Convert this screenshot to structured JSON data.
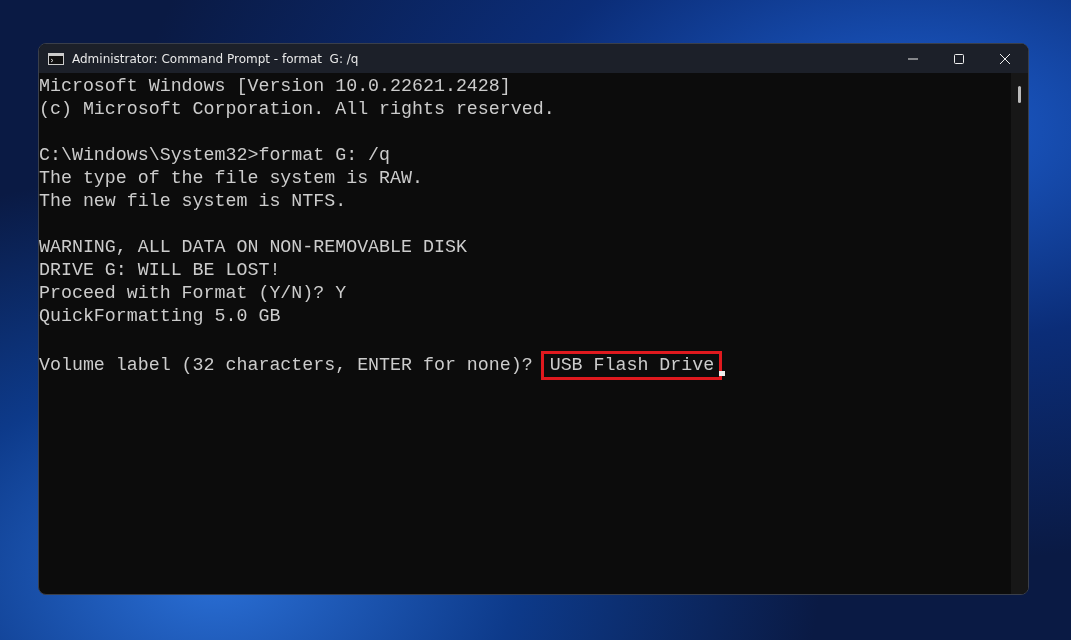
{
  "window": {
    "title": "Administrator: Command Prompt - format  G: /q"
  },
  "console": {
    "blocks": [
      [
        "Microsoft Windows [Version 10.0.22621.2428]",
        "(c) Microsoft Corporation. All rights reserved."
      ],
      [
        "C:\\Windows\\System32>format G: /q",
        "The type of the file system is RAW.",
        "The new file system is NTFS."
      ],
      [
        "WARNING, ALL DATA ON NON-REMOVABLE DISK",
        "DRIVE G: WILL BE LOST!",
        "Proceed with Format (Y/N)? Y",
        "QuickFormatting 5.0 GB"
      ]
    ],
    "prompt": {
      "text": "Volume label (32 characters, ENTER for none)? ",
      "input": "USB Flash Drive",
      "highlighted": true
    }
  }
}
